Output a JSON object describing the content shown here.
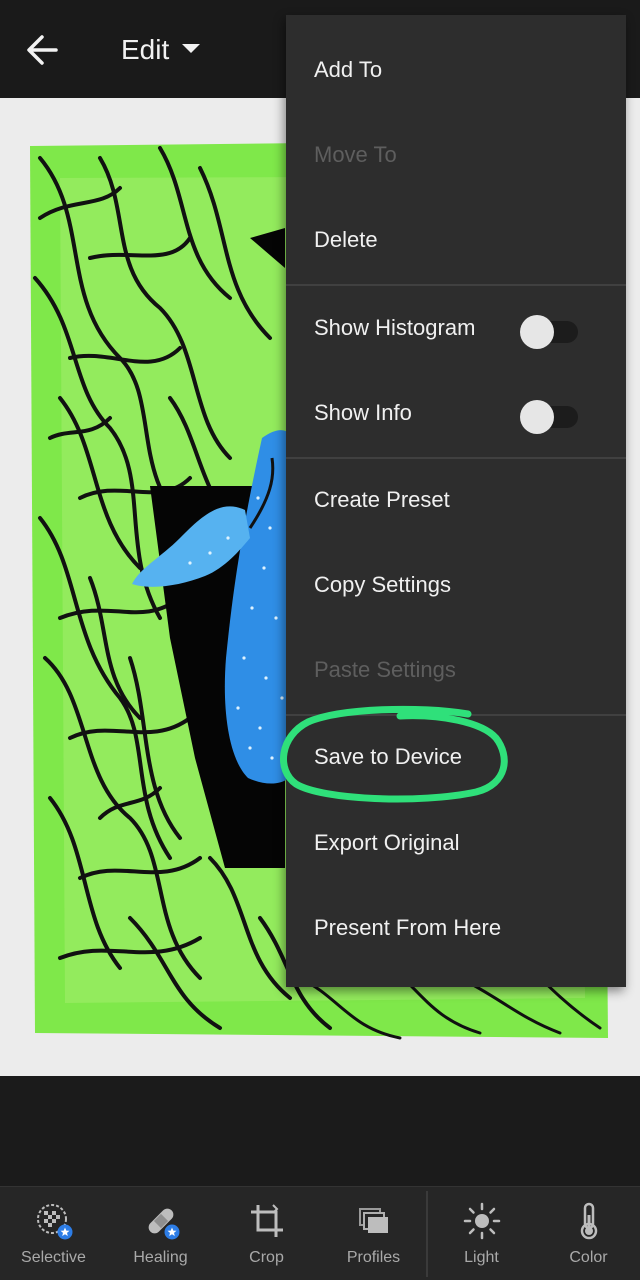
{
  "header": {
    "title": "Edit",
    "back_icon": "arrow-left-icon",
    "caret_icon": "caret-down-icon"
  },
  "menu": {
    "items": [
      {
        "label": "Add To",
        "enabled": true
      },
      {
        "label": "Move To",
        "enabled": false
      },
      {
        "label": "Delete",
        "enabled": true
      },
      {
        "label": "Show Histogram",
        "enabled": true,
        "toggle": false
      },
      {
        "label": "Show Info",
        "enabled": true,
        "toggle": false
      },
      {
        "label": "Create Preset",
        "enabled": true
      },
      {
        "label": "Copy Settings",
        "enabled": true
      },
      {
        "label": "Paste Settings",
        "enabled": false
      },
      {
        "label": "Save to Device",
        "enabled": true,
        "highlighted": true
      },
      {
        "label": "Export Original",
        "enabled": true
      },
      {
        "label": "Present From Here",
        "enabled": true
      }
    ]
  },
  "toolbar": {
    "items": [
      {
        "label": "Selective",
        "icon": "selective-icon"
      },
      {
        "label": "Healing",
        "icon": "healing-bandage-icon"
      },
      {
        "label": "Crop",
        "icon": "crop-icon"
      },
      {
        "label": "Profiles",
        "icon": "profiles-icon"
      },
      {
        "label": "Light",
        "icon": "sun-icon"
      },
      {
        "label": "Color",
        "icon": "thermometer-icon"
      }
    ]
  },
  "colors": {
    "menu_bg": "#2d2d2d",
    "highlight_stroke": "#2fe07a",
    "artwork_green": "#7fe84a",
    "whale_blue": "#2f8ee6",
    "premium_badge": "#2d7de6"
  }
}
